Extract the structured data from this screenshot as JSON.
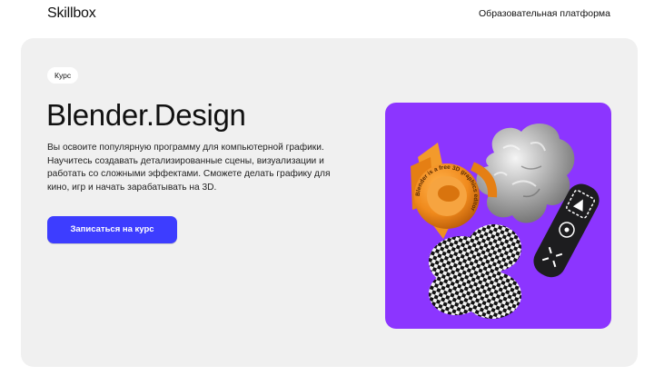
{
  "header": {
    "logo": "Skillbox",
    "platform_link": "Образовательная платформа"
  },
  "hero": {
    "badge": "Курс",
    "title": "Blender.Design",
    "description": "Вы освоите популярную программу для компьютерной графики. Научитесь создавать детализированные сцены, визуализации и работать со сложными эффектами. Сможете делать графику для кино, игр и начать зарабатывать на 3D.",
    "cta_label": "Записаться на курс"
  },
  "artwork": {
    "background_color": "#8c35ff",
    "ring_text": "Blender is a free 3D graphics editor",
    "objects": [
      "orange-3d-shapes",
      "silver-foil-blob",
      "checkered-flower",
      "dark-control-pad"
    ]
  },
  "colors": {
    "accent": "#3d3dff",
    "card_bg": "#f0f0f0",
    "art_bg": "#8c35ff"
  }
}
